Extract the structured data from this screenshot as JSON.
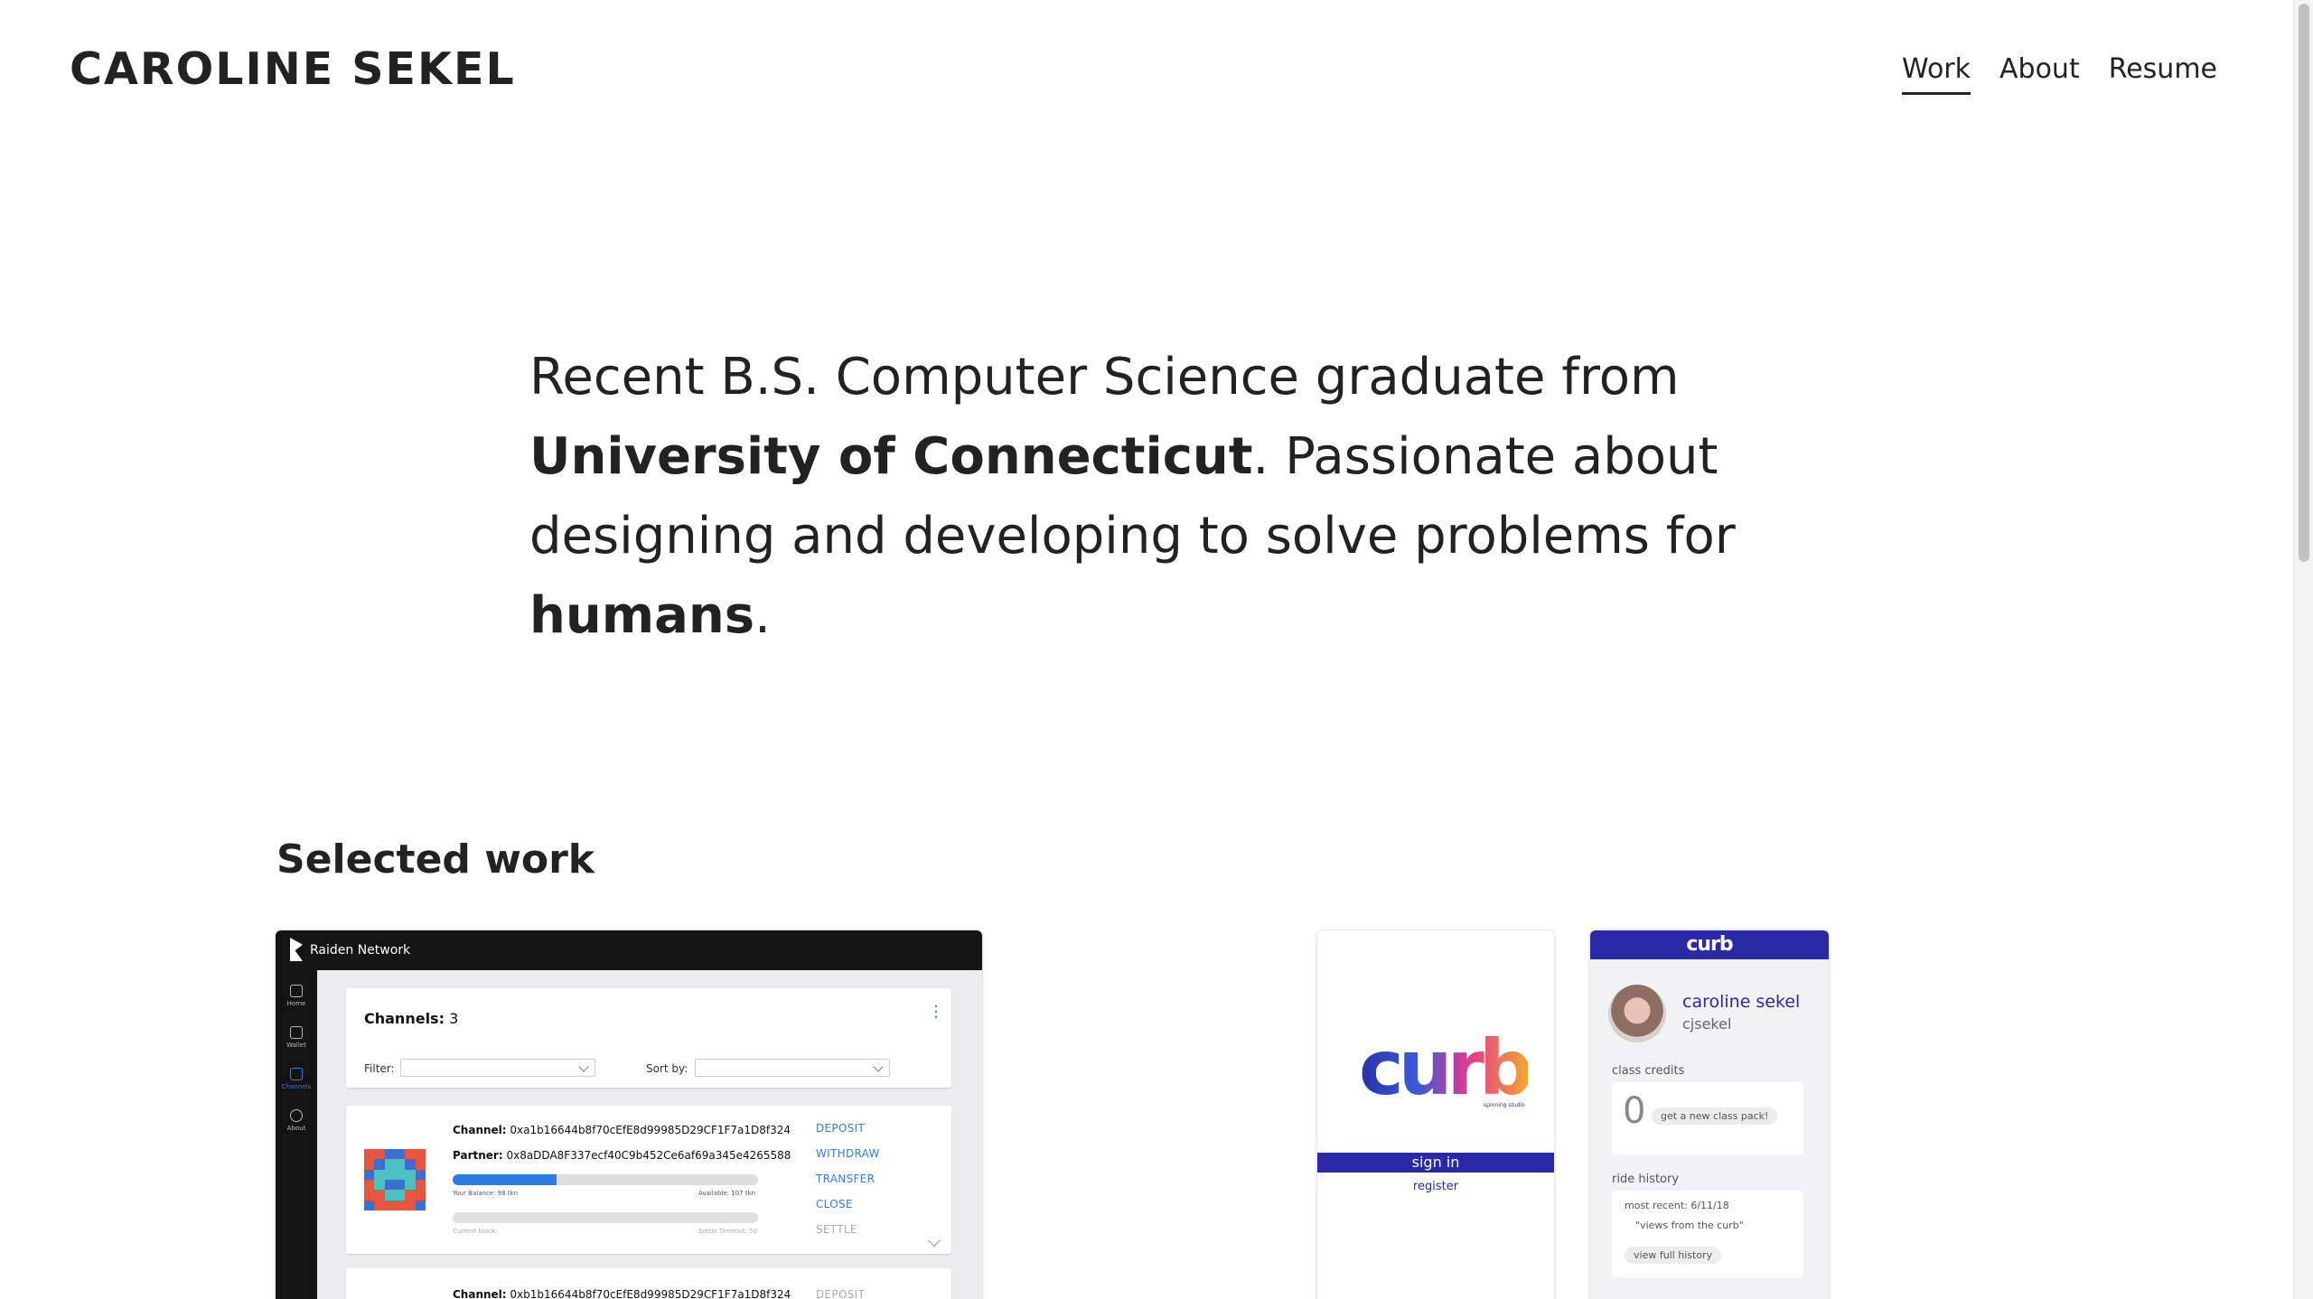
{
  "header": {
    "site_title": "CAROLINE SEKEL",
    "nav": [
      {
        "label": "Work",
        "active": true
      },
      {
        "label": "About",
        "active": false
      },
      {
        "label": "Resume",
        "active": false
      }
    ]
  },
  "intro": {
    "part1": "Recent B.S. Computer Science graduate from ",
    "bold1": "University of Connecticut",
    "part2": ". Passionate about designing and developing to solve problems for ",
    "bold2": "humans",
    "part3": "."
  },
  "selected_work": {
    "heading": "Selected work"
  },
  "raiden_preview": {
    "brand": "Raiden Network",
    "sidebar": [
      "Home",
      "Wallet",
      "Channels",
      "About"
    ],
    "channels_label": "Channels:",
    "channels_count": "3",
    "filter_label": "Filter:",
    "sort_label": "Sort by:",
    "channel_label": "Channel:",
    "channel_1": "0xa1b16644b8f70cEfE8d99985D29CF1F7a1D8f324",
    "partner_label": "Partner:",
    "partner_1": "0x8aDDA8F337ecf40C9b452Ce6af69a345e4265588",
    "balance_1": "Your Balance: 98 tkn",
    "available_1": "Available: 107 tkn",
    "current_block": "Current block:",
    "settle_timeout": "Settle Timeout: 50",
    "balance_fraction": 0.34,
    "actions": [
      "DEPOSIT",
      "WITHDRAW",
      "TRANSFER",
      "CLOSE",
      "SETTLE"
    ],
    "channel_2": "0xb1b16644b8f70cEfE8d99985D29CF1F7a1D8f324",
    "action_2": "DEPOSIT"
  },
  "curb_login": {
    "logo": "curb",
    "tagline": "spinning studio",
    "sign_in": "sign in",
    "register": "register"
  },
  "curb_profile": {
    "logo": "curb",
    "name": "caroline sekel",
    "username": "cjsekel",
    "credits_label": "class credits",
    "credits_value": "0",
    "get_pack": "get a new class pack!",
    "history_label": "ride history",
    "most_recent": "most recent: 6/11/18",
    "recent_ride": "\"views from the curb\"",
    "view_history": "view full history"
  },
  "colors": {
    "text": "#222222",
    "raiden_blue": "#3a7bd5",
    "curb_indigo": "#2a2aa8"
  }
}
